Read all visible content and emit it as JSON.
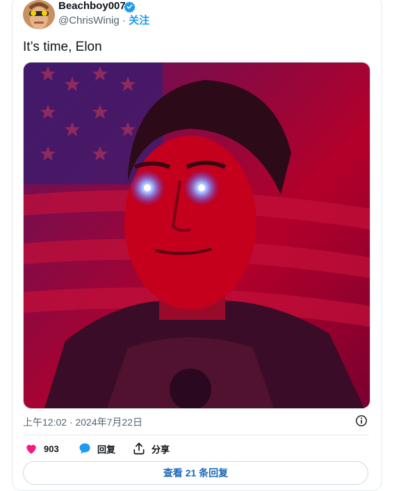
{
  "tweet": {
    "display_name": "Beachboy007",
    "handle": "@ChrisWinig",
    "separator": "·",
    "follow_label": "关注",
    "text": "It’s time, Elon",
    "timestamp": "上午12:02 · 2024年7月22日",
    "likes_count": "903",
    "reply_label": "回复",
    "share_label": "分享",
    "view_replies_label": "查看 21 条回复"
  },
  "icons": {
    "verified": "verified-badge-icon",
    "info": "info-icon",
    "like": "heart-icon",
    "reply": "reply-bubble-icon",
    "share": "share-icon"
  },
  "colors": {
    "accent": "#1d9bf0",
    "like": "#f91880",
    "muted": "#536471"
  }
}
